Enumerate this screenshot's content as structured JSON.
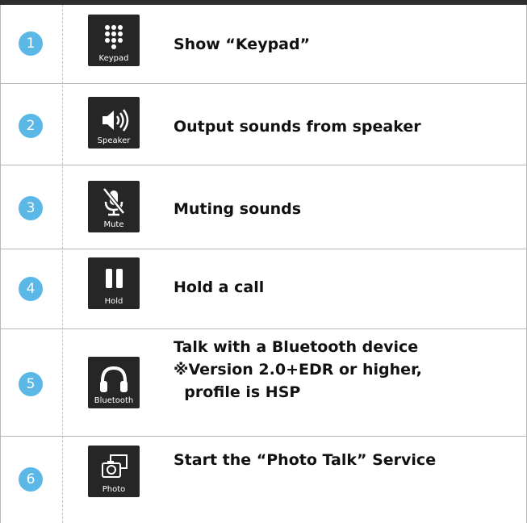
{
  "rows": [
    {
      "number": "1",
      "icon": "keypad-icon",
      "icon_label": "Keypad",
      "text": "Show “Keypad”"
    },
    {
      "number": "2",
      "icon": "speaker-icon",
      "icon_label": "Speaker",
      "text": "Output sounds from speaker"
    },
    {
      "number": "3",
      "icon": "mute-icon",
      "icon_label": "Mute",
      "text": "Muting sounds"
    },
    {
      "number": "4",
      "icon": "hold-icon",
      "icon_label": "Hold",
      "text": "Hold a call"
    },
    {
      "number": "5",
      "icon": "bluetooth-headphones-icon",
      "icon_label": "Bluetooth",
      "text_lines": [
        "Talk with a Bluetooth device",
        "※Version 2.0+EDR or higher,",
        "  profile is HSP"
      ]
    },
    {
      "number": "6",
      "icon": "photo-icon",
      "icon_label": "Photo",
      "text": "Start the “Photo Talk” Service"
    }
  ],
  "colors": {
    "number_badge": "#5bb8e6",
    "icon_bg": "#262626",
    "border": "#b8b8b8",
    "top_bar": "#2e2e2e"
  }
}
